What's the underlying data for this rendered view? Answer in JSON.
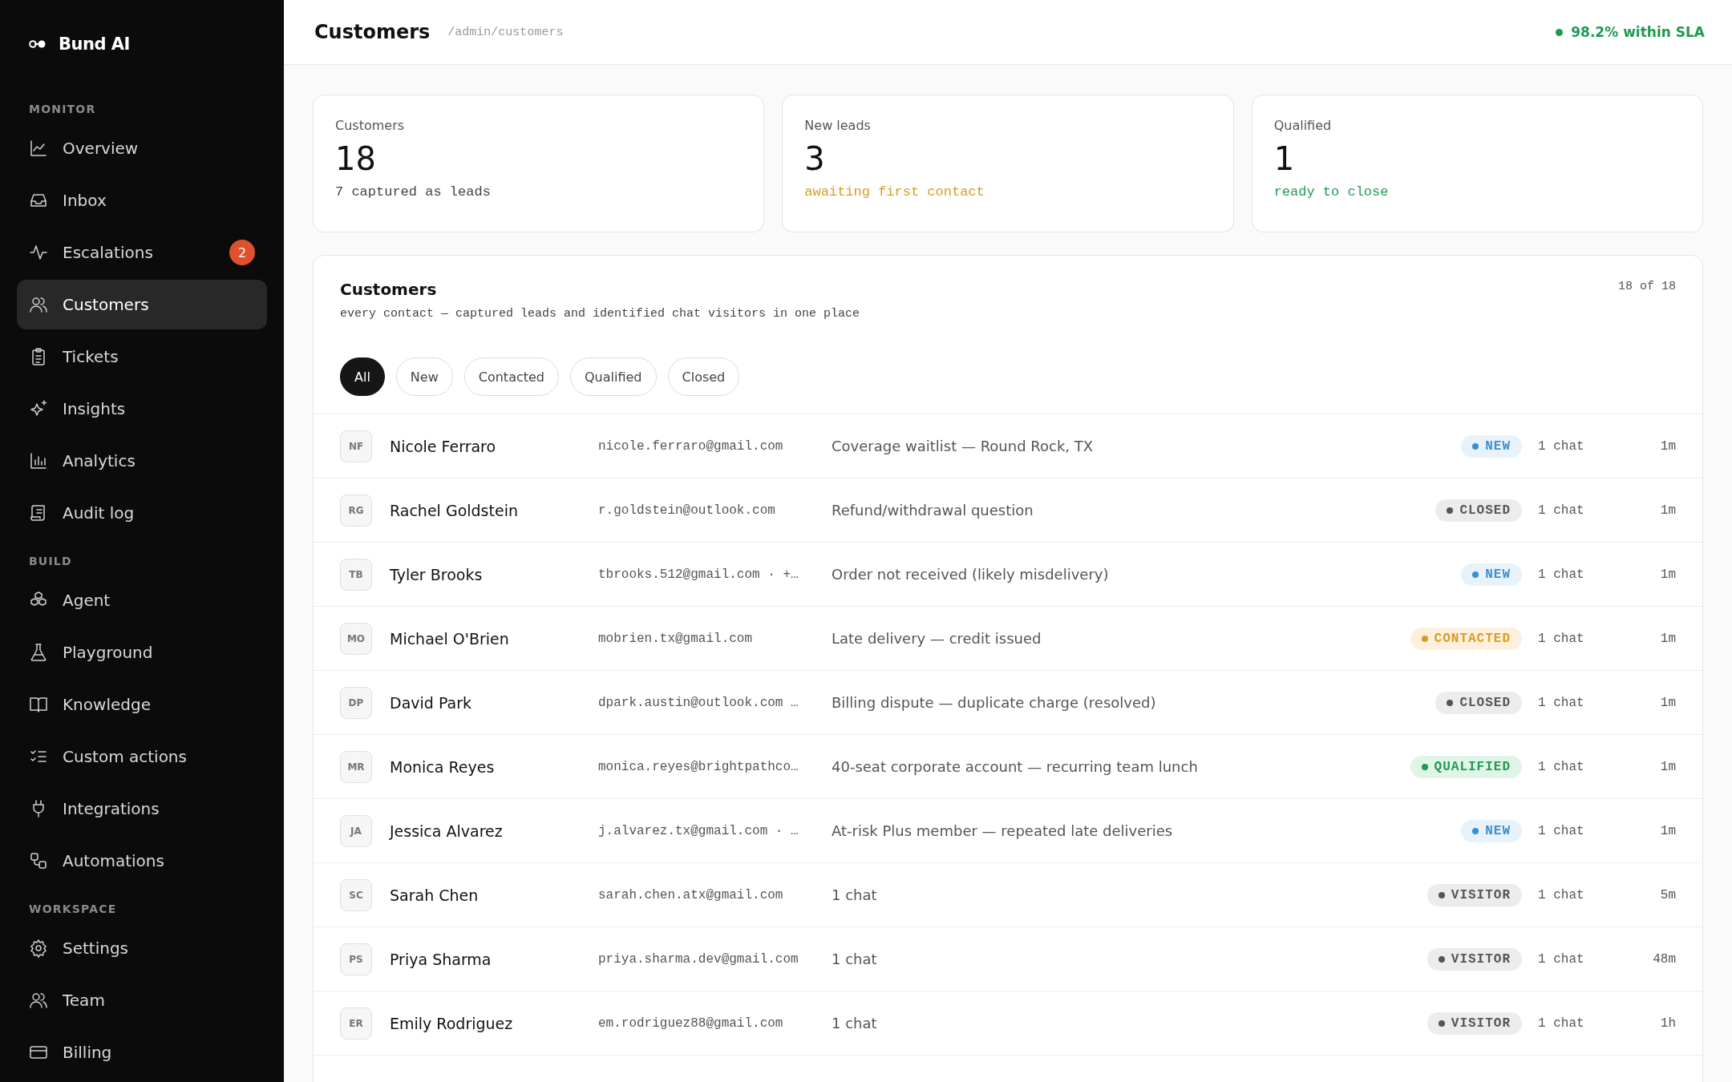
{
  "brand": {
    "name": "Bund AI"
  },
  "sidebar": {
    "sections": [
      {
        "label": "MONITOR",
        "items": [
          {
            "label": "Overview",
            "kind": "chart",
            "selected": false
          },
          {
            "label": "Inbox",
            "kind": "inbox",
            "selected": false
          },
          {
            "label": "Escalations",
            "kind": "pulse",
            "selected": false,
            "badge": "2"
          },
          {
            "label": "Customers",
            "kind": "users",
            "selected": true
          },
          {
            "label": "Tickets",
            "kind": "clipboard",
            "selected": false
          },
          {
            "label": "Insights",
            "kind": "sparkle",
            "selected": false
          },
          {
            "label": "Analytics",
            "kind": "bars",
            "selected": false
          },
          {
            "label": "Audit log",
            "kind": "scroll",
            "selected": false
          }
        ]
      },
      {
        "label": "BUILD",
        "items": [
          {
            "label": "Agent",
            "kind": "cubes",
            "selected": false
          },
          {
            "label": "Playground",
            "kind": "flask",
            "selected": false
          },
          {
            "label": "Knowledge",
            "kind": "book",
            "selected": false
          },
          {
            "label": "Custom actions",
            "kind": "checklist",
            "selected": false
          },
          {
            "label": "Integrations",
            "kind": "plug",
            "selected": false
          },
          {
            "label": "Automations",
            "kind": "flow",
            "selected": false
          }
        ]
      },
      {
        "label": "WORKSPACE",
        "items": [
          {
            "label": "Settings",
            "kind": "gear",
            "selected": false
          },
          {
            "label": "Team",
            "kind": "users",
            "selected": false
          },
          {
            "label": "Billing",
            "kind": "card",
            "selected": false
          }
        ]
      }
    ]
  },
  "header": {
    "title": "Customers",
    "path": "/admin/customers",
    "sla": "98.2% within SLA"
  },
  "stats": [
    {
      "label": "Customers",
      "value": "18",
      "note": "7 captured as leads",
      "kind": "neutral"
    },
    {
      "label": "New leads",
      "value": "3",
      "note": "awaiting first contact",
      "kind": "warning"
    },
    {
      "label": "Qualified",
      "value": "1",
      "note": "ready to close",
      "kind": "success"
    }
  ],
  "table": {
    "title": "Customers",
    "subtitle": "every contact — captured leads and identified chat visitors in one place",
    "count": "18 of 18",
    "filters": [
      {
        "label": "All",
        "selected": true
      },
      {
        "label": "New",
        "selected": false
      },
      {
        "label": "Contacted",
        "selected": false
      },
      {
        "label": "Qualified",
        "selected": false
      },
      {
        "label": "Closed",
        "selected": false
      }
    ],
    "rows": [
      {
        "initials": "NF",
        "name": "Nicole Ferraro",
        "email": "nicole.ferraro@gmail.com",
        "summary": "Coverage waitlist — Round Rock, TX",
        "status": {
          "label": "NEW",
          "kind": "new"
        },
        "chats": "1 chat",
        "age": "1m"
      },
      {
        "initials": "RG",
        "name": "Rachel Goldstein",
        "email": "r.goldstein@outlook.com",
        "summary": "Refund/withdrawal question",
        "status": {
          "label": "CLOSED",
          "kind": "closed"
        },
        "chats": "1 chat",
        "age": "1m"
      },
      {
        "initials": "TB",
        "name": "Tyler Brooks",
        "email": "tbrooks.512@gmail.com · +…",
        "summary": "Order not received (likely misdelivery)",
        "status": {
          "label": "NEW",
          "kind": "new"
        },
        "chats": "1 chat",
        "age": "1m"
      },
      {
        "initials": "MO",
        "name": "Michael O'Brien",
        "email": "mobrien.tx@gmail.com",
        "summary": "Late delivery — credit issued",
        "status": {
          "label": "CONTACTED",
          "kind": "contacted"
        },
        "chats": "1 chat",
        "age": "1m"
      },
      {
        "initials": "DP",
        "name": "David Park",
        "email": "dpark.austin@outlook.com …",
        "summary": "Billing dispute — duplicate charge (resolved)",
        "status": {
          "label": "CLOSED",
          "kind": "closed"
        },
        "chats": "1 chat",
        "age": "1m"
      },
      {
        "initials": "MR",
        "name": "Monica Reyes",
        "email": "monica.reyes@brightpathco…",
        "summary": "40-seat corporate account — recurring team lunch",
        "status": {
          "label": "QUALIFIED",
          "kind": "qualified"
        },
        "chats": "1 chat",
        "age": "1m"
      },
      {
        "initials": "JA",
        "name": "Jessica Alvarez",
        "email": "j.alvarez.tx@gmail.com · …",
        "summary": "At-risk Plus member — repeated late deliveries",
        "status": {
          "label": "NEW",
          "kind": "new"
        },
        "chats": "1 chat",
        "age": "1m"
      },
      {
        "initials": "SC",
        "name": "Sarah Chen",
        "email": "sarah.chen.atx@gmail.com",
        "summary": "1 chat",
        "status": {
          "label": "VISITOR",
          "kind": "visitor"
        },
        "chats": "1 chat",
        "age": "5m"
      },
      {
        "initials": "PS",
        "name": "Priya Sharma",
        "email": "priya.sharma.dev@gmail.com",
        "summary": "1 chat",
        "status": {
          "label": "VISITOR",
          "kind": "visitor"
        },
        "chats": "1 chat",
        "age": "48m"
      },
      {
        "initials": "ER",
        "name": "Emily Rodriguez",
        "email": "em.rodriguez88@gmail.com",
        "summary": "1 chat",
        "status": {
          "label": "VISITOR",
          "kind": "visitor"
        },
        "chats": "1 chat",
        "age": "1h"
      }
    ]
  }
}
